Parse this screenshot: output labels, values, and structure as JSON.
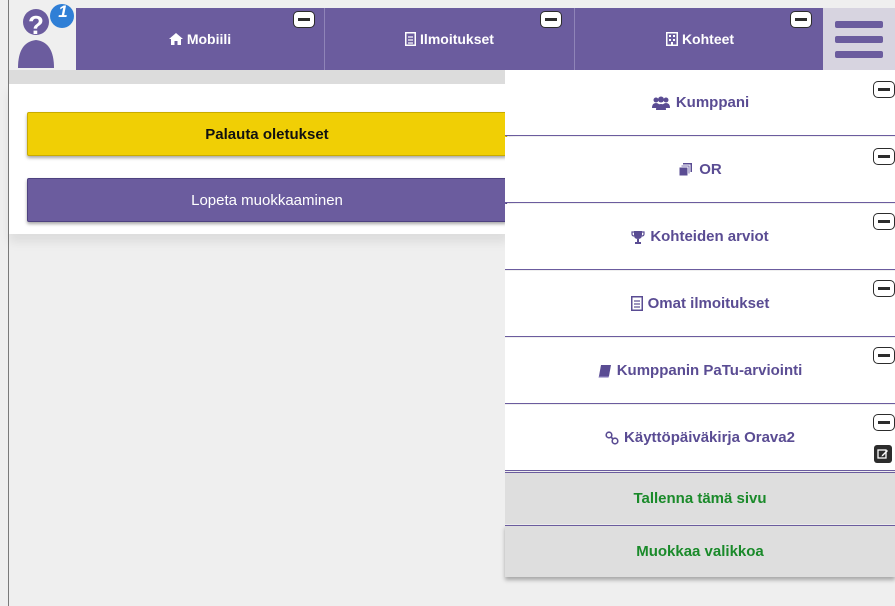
{
  "notification": {
    "count": "1",
    "icon": "help-user-icon"
  },
  "nav": {
    "tabs": [
      {
        "label": "Mobiili",
        "icon": "home-icon"
      },
      {
        "label": "Ilmoitukset",
        "icon": "document-icon"
      },
      {
        "label": "Kohteet",
        "icon": "building-icon"
      }
    ],
    "menu_icon": "hamburger-menu-icon"
  },
  "content": {
    "reset_label": "Palauta oletukset",
    "stop_label": "Lopeta muokkaaminen"
  },
  "dropdown": {
    "items": [
      {
        "label": "Kumppani",
        "icon": "users-icon"
      },
      {
        "label": "OR",
        "icon": "stack-icon"
      },
      {
        "label": "Kohteiden arviot",
        "icon": "trophy-icon"
      },
      {
        "label": "Omat ilmoitukset",
        "icon": "document-icon"
      },
      {
        "label": "Kumppanin PaTu-arviointi",
        "icon": "book-icon"
      },
      {
        "label": "Käyttöpäiväkirja Orava2",
        "icon": "link-icon"
      }
    ],
    "save_label": "Tallenna tämä sivu",
    "edit_menu_label": "Muokkaa valikkoa"
  },
  "colors": {
    "nav_purple": "#6b5c9e",
    "reset_yellow": "#f0cf05",
    "action_green": "#1a8a2a"
  }
}
